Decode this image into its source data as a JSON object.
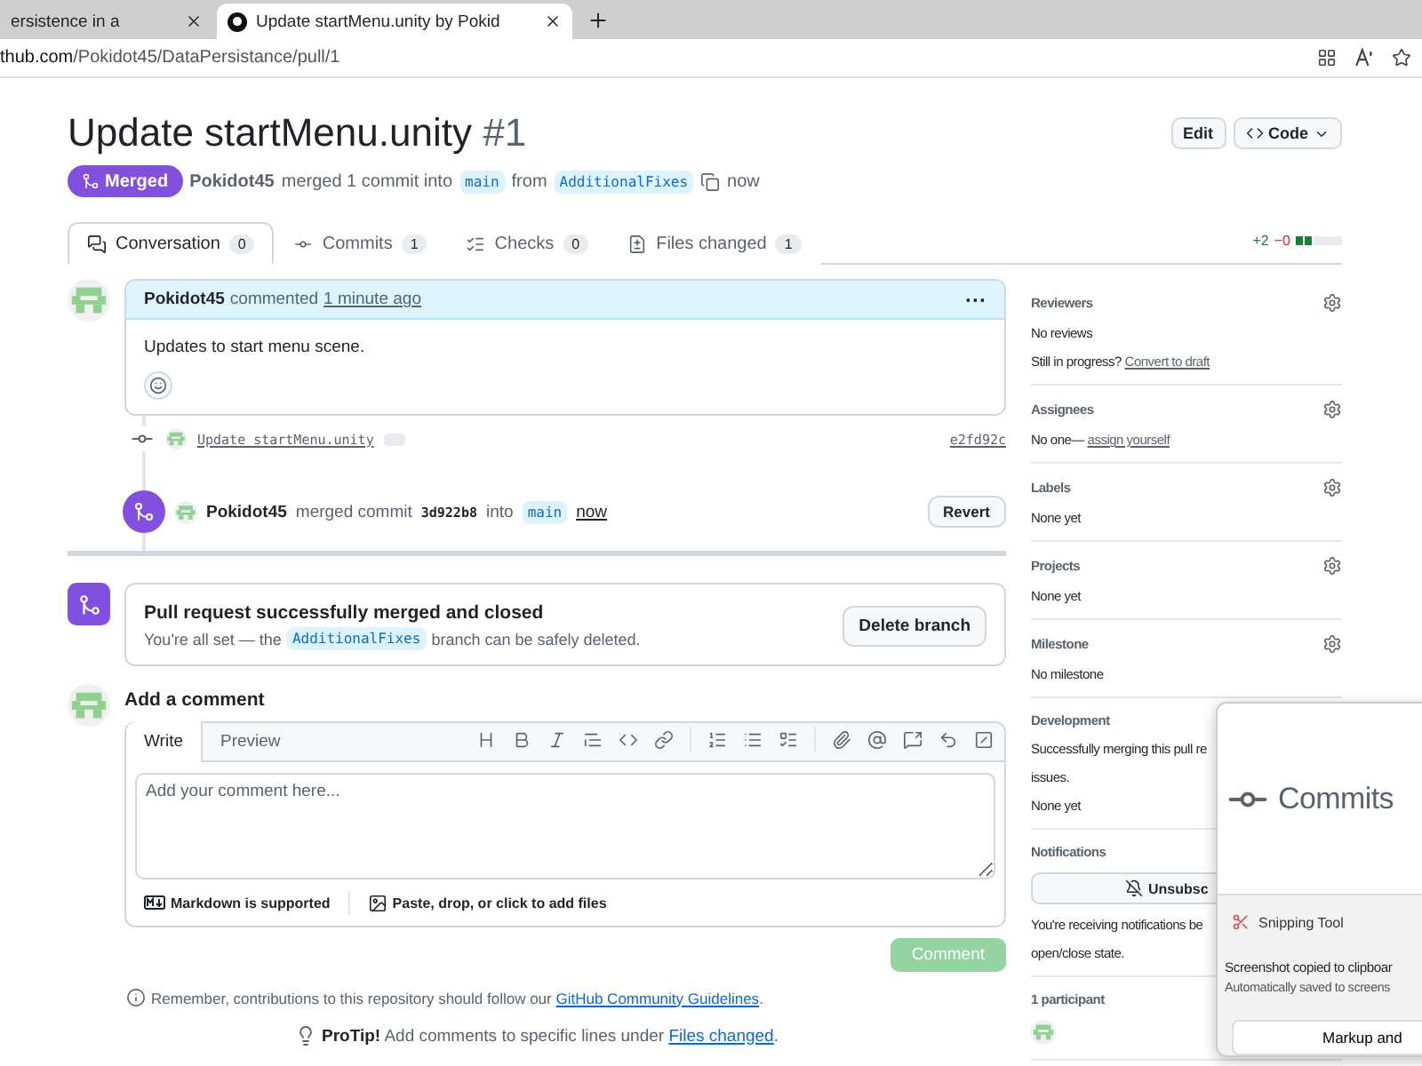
{
  "browser": {
    "tabs": [
      {
        "title": "ersistence in a",
        "selected": false
      },
      {
        "title": "Update startMenu.unity by Pokid",
        "selected": true
      }
    ],
    "address": {
      "host": "thub.com",
      "path": "/Pokidot45/DataPersistance/pull/1"
    }
  },
  "header": {
    "title": "Update startMenu.unity",
    "number": "#1",
    "edit": "Edit",
    "code": "Code",
    "status": "Merged",
    "author": "Pokidot45",
    "summary": "merged 1 commit into",
    "base": "main",
    "from": "from",
    "head": "AdditionalFixes",
    "time": "now"
  },
  "tabs": [
    {
      "label": "Conversation",
      "count": "0",
      "selected": true
    },
    {
      "label": "Commits",
      "count": "1",
      "selected": false
    },
    {
      "label": "Checks",
      "count": "0",
      "selected": false
    },
    {
      "label": "Files changed",
      "count": "1",
      "selected": false
    }
  ],
  "diffstat": {
    "added": "+2",
    "removed": "−0"
  },
  "comment": {
    "author": "Pokidot45",
    "action": "commented",
    "time": "1 minute ago",
    "menu": "···",
    "body": "Updates to start menu scene."
  },
  "commit": {
    "message": "Update startMenu.unity",
    "sha": "e2fd92c"
  },
  "merge_event": {
    "author": "Pokidot45",
    "action": "merged commit",
    "sha": "3d922b8",
    "into": "into",
    "base": "main",
    "time": "now",
    "button": "Revert"
  },
  "merge_box": {
    "title": "Pull request successfully merged and closed",
    "before": "You're all set — the",
    "branch": "AdditionalFixes",
    "after": "branch can be safely deleted.",
    "button": "Delete branch"
  },
  "comment_form": {
    "heading": "Add a comment",
    "tabs": [
      {
        "label": "Write",
        "selected": true
      },
      {
        "label": "Preview",
        "selected": false
      }
    ],
    "placeholder": "Add your comment here...",
    "markdown": "Markdown is supported",
    "files": "Paste, drop, or click to add files",
    "button": "Comment",
    "disabled": true
  },
  "guidelines": {
    "text": "Remember, contributions to this repository should follow our",
    "link": "GitHub Community Guidelines",
    "end": "."
  },
  "protip": {
    "text": "**ProTip!** Add comments to specific lines under",
    "link": "Files changed",
    "end": "."
  },
  "sidebar": [
    {
      "title": "Reviewers",
      "settings": true,
      "lines": [
        {
          "text": "No reviews"
        },
        {
          "text": "Still in progress?",
          "link": "Convert to draft"
        }
      ]
    },
    {
      "title": "Assignees",
      "settings": true,
      "lines": [
        {
          "text": "No one—",
          "link": "assign yourself"
        }
      ]
    },
    {
      "title": "Labels",
      "settings": true,
      "lines": [
        {
          "text": "None yet"
        }
      ]
    },
    {
      "title": "Projects",
      "settings": true,
      "lines": [
        {
          "text": "None yet"
        }
      ]
    },
    {
      "title": "Milestone",
      "settings": true,
      "lines": [
        {
          "text": "No milestone"
        }
      ]
    },
    {
      "title": "Development",
      "settings": false,
      "lines": [
        {
          "text": "Successfully merging this pull re"
        },
        {
          "text": "issues."
        },
        {
          "text": "None yet"
        }
      ]
    },
    {
      "title": "Notifications",
      "settings": false,
      "button": "Unsubsc",
      "lines": [
        {
          "text": "You're receiving notifications be"
        },
        {
          "text": "open/close state."
        }
      ]
    },
    {
      "title": "1 participant",
      "settings": false,
      "kind": "participants"
    }
  ],
  "snip": {
    "preview": "Commits",
    "app": "Snipping Tool",
    "title": "Screenshot copied to clipboar",
    "subtitle": "Automatically saved to screens",
    "button": "Markup and"
  }
}
